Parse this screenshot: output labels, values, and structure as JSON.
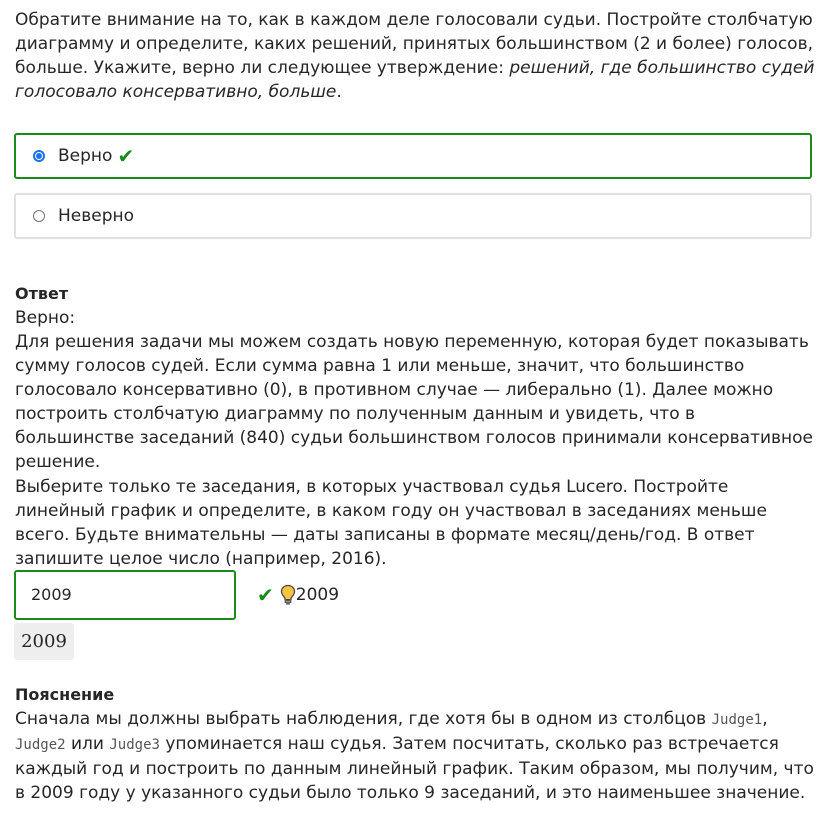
{
  "question1": {
    "text": "Обратите внимание на то, как в каждом деле голосовали судьи. Постройте столбчатую диаграмму и определите, каких решений, принятых большинством (2 и более) голосов, больше. Укажите, верно ли следующее утверждение: ",
    "statement": "решений, где большинство судей голосовало консервативно, больше",
    "end": "."
  },
  "options": [
    {
      "label": "Верно",
      "selected": true,
      "correct": true
    },
    {
      "label": "Неверно",
      "selected": false,
      "correct": false
    }
  ],
  "answer": {
    "heading": "Ответ",
    "value": "Верно:",
    "text": "Для решения задачи мы можем создать новую переменную, которая будет показывать сумму голосов судей. Если сумма равна 1 или меньше, значит, что большинство голосовало консервативно (0), в противном случае — либерально (1). Далее можно построить столбчатую диаграмму по полученным данным и увидеть, что в большинстве заседаний (840) судьи большинством голосов принимали консервативное решение."
  },
  "question2": {
    "text": "Выберите только те заседания, в которых участвовал судья Lucero. Постройте линейный график и определите, в каком году он участвовал в заседаниях меньше всего. Будьте внимательны — даты записаны в формате месяц/день/год. В ответ запишите целое число (например, 2016)."
  },
  "answer_input": {
    "value": "2009",
    "feedback_value": "2009",
    "correct_answer": "2009"
  },
  "explanation": {
    "heading": "Пояснение",
    "part1": "Сначала мы должны выбрать наблюдения, где хотя бы в одном из столбцов ",
    "col1": "Judge1",
    "sep1": ", ",
    "col2": "Judge2",
    "part2": " или ",
    "col3": "Judge3",
    "part3": " упоминается наш судья. Затем посчитать, сколько раз встречается каждый год и построить по данным линейный график. Таким образом, мы получим, что в 2009 году у указанного судьи было только 9 заседаний, и это наименьшее значение."
  },
  "colors": {
    "correct": "#1a8a1a",
    "radio": "#1a73e8",
    "bulb": "#f5c542"
  },
  "icons": {
    "check": "check-icon",
    "bulb": "lightbulb-icon"
  }
}
